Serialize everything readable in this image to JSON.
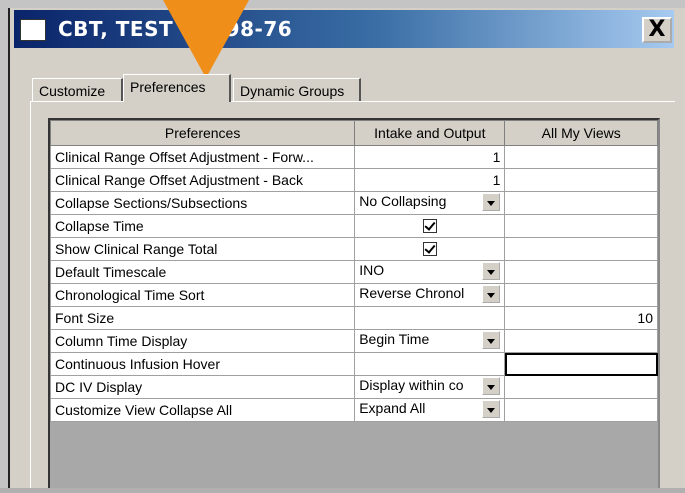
{
  "window": {
    "title": "CBT, TEST 1 8-98-76",
    "close_label": "X"
  },
  "tabs": [
    {
      "label": "Customize",
      "active": false
    },
    {
      "label": "Preferences",
      "active": true
    },
    {
      "label": "Dynamic Groups",
      "active": false
    }
  ],
  "grid": {
    "headers": [
      "Preferences",
      "Intake and Output",
      "All My Views"
    ],
    "rows": [
      {
        "pref": "Clinical Range Offset Adjustment - Forw...",
        "io": "1",
        "io_type": "number",
        "all": ""
      },
      {
        "pref": "Clinical Range Offset Adjustment - Back",
        "io": "1",
        "io_type": "number",
        "all": ""
      },
      {
        "pref": "Collapse Sections/Subsections",
        "io": "No Collapsing",
        "io_type": "dropdown",
        "all": ""
      },
      {
        "pref": "Collapse Time",
        "io": "",
        "io_type": "checkbox",
        "checked": true,
        "all": ""
      },
      {
        "pref": "Show Clinical Range Total",
        "io": "",
        "io_type": "checkbox",
        "checked": true,
        "all": ""
      },
      {
        "pref": "Default Timescale",
        "io": "INO",
        "io_type": "dropdown",
        "all": ""
      },
      {
        "pref": "Chronological Time Sort",
        "io": "Reverse Chronol",
        "io_type": "dropdown",
        "all": ""
      },
      {
        "pref": "Font Size",
        "io": "",
        "io_type": "text",
        "all": "10"
      },
      {
        "pref": "Column Time Display",
        "io": "Begin Time",
        "io_type": "dropdown",
        "all": ""
      },
      {
        "pref": "Continuous Infusion Hover",
        "io": "",
        "io_type": "text",
        "all": "",
        "selected_all": true
      },
      {
        "pref": "DC IV Display",
        "io": "Display within co",
        "io_type": "dropdown",
        "all": ""
      },
      {
        "pref": "Customize View Collapse All",
        "io": "Expand All",
        "io_type": "dropdown",
        "all": ""
      }
    ]
  },
  "colors": {
    "accent_arrow": "#f08e1a",
    "title_bar_start": "#0a246a",
    "title_bar_end": "#a6caf0",
    "dialog_bg": "#d4d0c8"
  }
}
